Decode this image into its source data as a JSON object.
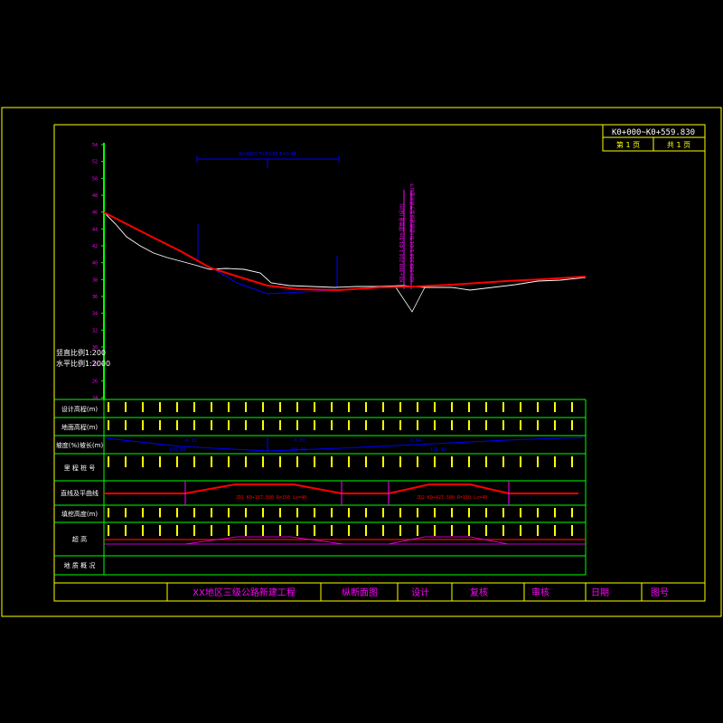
{
  "sheet": {
    "station_range": "K0+000~K0+559.830",
    "page_label": "第 1 页",
    "total_label": "共 1 页"
  },
  "scale": {
    "vertical": "竖直比例1:200",
    "horizontal": "水平比例1:2000"
  },
  "elevation_ticks": [
    "54",
    "52",
    "50",
    "48",
    "46",
    "44",
    "42",
    "40",
    "38",
    "36",
    "34",
    "32",
    "30",
    "28",
    "26",
    "24"
  ],
  "row_labels": {
    "design_elev": "设计高程(m)",
    "ground_elev": "地面高程(m)",
    "grade": "坡度(%)坡长(m)",
    "station": "里 程 桩 号",
    "alignment": "直线及平曲线",
    "ground_row": "填挖高度(m)",
    "superelev": "超 高",
    "geology": "地 质 概 况"
  },
  "annotations": {
    "vertical_curve": "R=8000 T=83.89 E=0.44",
    "culvert": "K0+369.216 1-Φ1.5m 圆管涵 (设计)",
    "culvert_note": "K0+369.216 1-Φ1.5m圆管涵设置于原地面以下"
  },
  "grade_segments": [
    {
      "text": "-4.19",
      "sub": "178.00"
    },
    {
      "text": "-0.89",
      "sub": "306.00"
    },
    {
      "text": "0.64",
      "sub": "175.83"
    }
  ],
  "curves": [
    {
      "text": "JD1 K0+157.500 R=150 Ls=40"
    },
    {
      "text": "JD2 K0+427.500 R=150 Ls=40"
    }
  ],
  "title_block": {
    "project": "XX地区三级公路新建工程",
    "drawing": "纵断面图",
    "design": "设计",
    "review": "复核",
    "approve": "审核",
    "date": "日期",
    "drawing_no": "图号"
  },
  "colors": {
    "frame": "#ffff00",
    "grid": "#00ff00",
    "design_line": "#ff0000",
    "ground_line": "#ffffff",
    "label": "#ff00ff",
    "blue": "#0000ff"
  }
}
